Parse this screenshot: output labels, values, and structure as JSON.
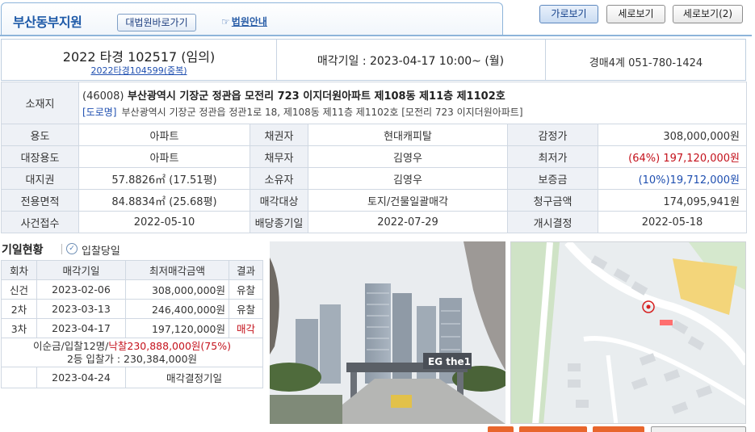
{
  "header": {
    "court_name": "부산동부지원",
    "btn_supreme": "대법원바로가기",
    "btn_court_guide": "법원안내",
    "view_buttons": [
      "가로보기",
      "세로보기",
      "세로보기(2)"
    ]
  },
  "summary": {
    "case_number": "2022 타경 102517 (임의)",
    "case_sub": "2022타경104599(중복)",
    "sale_date": "매각기일 : 2023-04-17 10:00~ (월)",
    "department": "경매4계 051-780-1424"
  },
  "address": {
    "label": "소재지",
    "zip": "(46008)",
    "main": "부산광역시 기장군 정관읍 모전리 723 이지더원아파트 제108동 제11층 제1102호",
    "road_tag": "[도로명]",
    "road": "부산광역시 기장군 정관읍 정관1로 18, 제108동 제11층 제1102호 [모전리 723 이지더원아파트]"
  },
  "info_rows": [
    [
      "용도",
      "아파트",
      "채권자",
      "현대캐피탈",
      "감정가",
      "308,000,000원"
    ],
    [
      "대장용도",
      "아파트",
      "채무자",
      "김영우",
      "최저가",
      "(64%) 197,120,000원"
    ],
    [
      "대지권",
      "57.8826㎡ (17.51평)",
      "소유자",
      "김영우",
      "보증금",
      "(10%)19,712,000원"
    ],
    [
      "전용면적",
      "84.8834㎡ (25.68평)",
      "매각대상",
      "토지/건물일괄매각",
      "청구금액",
      "174,095,941원"
    ],
    [
      "사건접수",
      "2022-05-10",
      "배당종기일",
      "2022-07-29",
      "개시결정",
      "2022-05-18"
    ]
  ],
  "bidding": {
    "title": "기일현황",
    "check_label": "입찰당일",
    "headers": [
      "회차",
      "매각기일",
      "최저매각금액",
      "결과"
    ],
    "rows": [
      [
        "신건",
        "2023-02-06",
        "308,000,000원",
        "유찰"
      ],
      [
        "2차",
        "2023-03-13",
        "246,400,000원",
        "유찰"
      ],
      [
        "3차",
        "2023-04-17",
        "197,120,000원",
        "매각"
      ]
    ],
    "note_prefix": "이순금/입찰12명/",
    "note_winning": "낙찰230,888,000원(75%)",
    "note_second": "2등 입찰가 : 230,384,000원",
    "final_date": "2023-04-24",
    "final_label": "매각결정기일"
  },
  "photo": {
    "sign_text": "EG the1"
  },
  "colors": {
    "accent_blue": "#1f4fb0",
    "highlight_red": "#c4121c",
    "header_border": "#8db4da"
  }
}
